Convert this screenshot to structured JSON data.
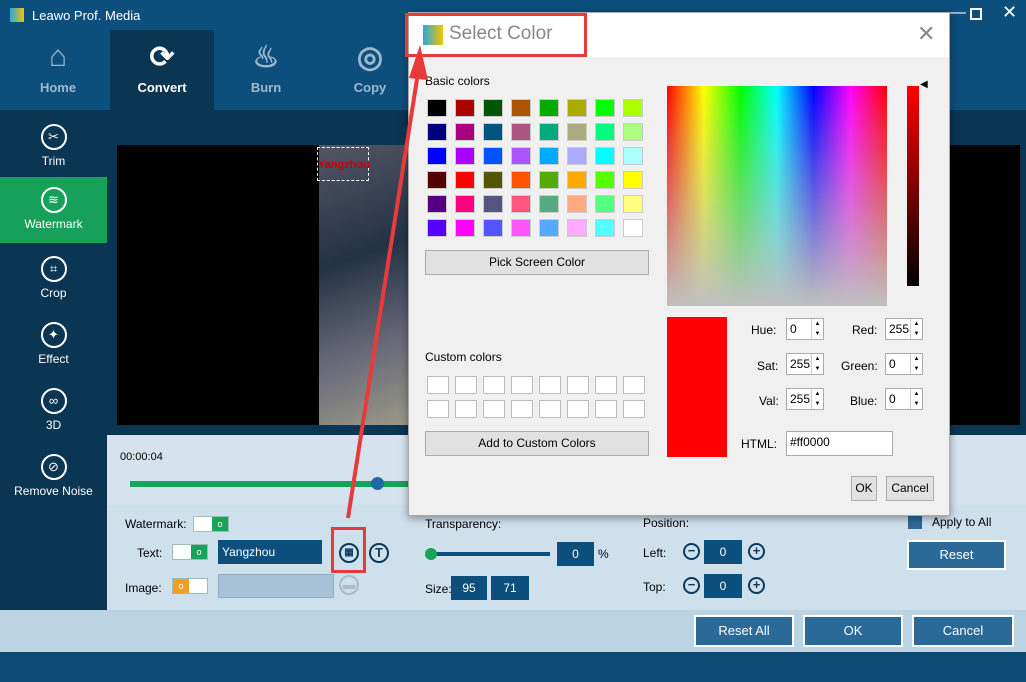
{
  "app": {
    "title": "Leawo Prof. Media"
  },
  "nav": [
    {
      "label": "Home",
      "icon": "home-icon"
    },
    {
      "label": "Convert",
      "icon": "convert-icon",
      "active": true
    },
    {
      "label": "Burn",
      "icon": "burn-icon"
    },
    {
      "label": "Copy",
      "icon": "copy-icon"
    }
  ],
  "sidebar": [
    {
      "label": "Trim"
    },
    {
      "label": "Watermark",
      "active": true
    },
    {
      "label": "Crop"
    },
    {
      "label": "Effect"
    },
    {
      "label": "3D"
    },
    {
      "label": "Remove Noise"
    }
  ],
  "preview": {
    "watermark_text": "Yangzhou"
  },
  "timeline": {
    "time": "00:00:04",
    "progress": 0.15
  },
  "watermark": {
    "watermark_label": "Watermark:",
    "text_label": "Text:",
    "text_value": "Yangzhou",
    "image_label": "Image:",
    "transparency_label": "Transparency:",
    "transparency_value": "0",
    "percent": "%",
    "size_label": "Size:",
    "size_w": "95",
    "size_h": "71",
    "position_label": "Position:",
    "left_label": "Left:",
    "left_value": "0",
    "top_label": "Top:",
    "top_value": "0",
    "apply_all": "Apply to All",
    "reset": "Reset",
    "watermark_on": true,
    "text_on": true,
    "image_on": false
  },
  "footer": {
    "reset_all": "Reset All",
    "ok": "OK",
    "cancel": "Cancel"
  },
  "dialog": {
    "title": "Select Color",
    "basic_colors_label": "Basic colors",
    "basic_colors": [
      "#000000",
      "#aa0000",
      "#005500",
      "#aa5500",
      "#00aa00",
      "#aaaa00",
      "#00ff00",
      "#aaff00",
      "#00007f",
      "#aa007f",
      "#00557f",
      "#aa557f",
      "#00aa7f",
      "#aaaa7f",
      "#00ff7f",
      "#aaff7f",
      "#0000ff",
      "#aa00ff",
      "#0055ff",
      "#aa55ff",
      "#00aaff",
      "#aaaaff",
      "#00ffff",
      "#aaffff",
      "#550000",
      "#ff0000",
      "#555500",
      "#ff5500",
      "#55aa00",
      "#ffaa00",
      "#55ff00",
      "#ffff00",
      "#55007f",
      "#ff007f",
      "#55557f",
      "#ff557f",
      "#55aa7f",
      "#ffaa7f",
      "#55ff7f",
      "#ffff7f",
      "#5500ff",
      "#ff00ff",
      "#5555ff",
      "#ff55ff",
      "#55aaff",
      "#ffaaff",
      "#55ffff",
      "#ffffff"
    ],
    "pick_screen": "Pick Screen Color",
    "custom_colors_label": "Custom colors",
    "add_custom": "Add to Custom Colors",
    "hue_label": "Hue:",
    "hue": "0",
    "sat_label": "Sat:",
    "sat": "255",
    "val_label": "Val:",
    "val": "255",
    "red_label": "Red:",
    "red": "255",
    "green_label": "Green:",
    "green": "0",
    "blue_label": "Blue:",
    "blue": "0",
    "html_label": "HTML:",
    "html": "#ff0000",
    "ok": "OK",
    "cancel": "Cancel",
    "current_color": "#ff0000"
  },
  "annotation_color": "#e8393b"
}
